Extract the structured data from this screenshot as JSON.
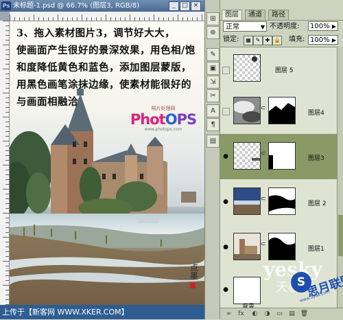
{
  "document": {
    "title": "未标题-1.psd @ 66.7% (图层3, RGB/8)",
    "instruction_lines": [
      "3、拖入素材图片3，调节好大大，",
      "使画面产生很好的景深效果，用色相/饱",
      "和度降低黄色和蓝色，添加图层蒙版，",
      "用黑色画笔涂抹边缘，使素材能很好的",
      "与画面相融洽"
    ],
    "logo_small": "照片处理网",
    "logo_big": "PhotoPS",
    "logo_url": "www.photops.com",
    "signature": "点墨",
    "footer": "上传于【新客网 WWW.XKER.COM】"
  },
  "tools": [
    "⊞",
    "⊕",
    "✎",
    "▣",
    "⇲",
    "✂",
    "A",
    "¶",
    "▤"
  ],
  "layers_panel": {
    "tabs": [
      "图层",
      "通道",
      "路径"
    ],
    "active_tab": 0,
    "blend_mode": "正常",
    "opacity_label": "不透明度:",
    "opacity_value": "100%",
    "lock_label": "锁定:",
    "fill_label": "填充:",
    "fill_value": "100%",
    "layers": [
      {
        "name": "图层 5",
        "visible": false,
        "mask": false,
        "selected": false
      },
      {
        "name": "图层4",
        "visible": false,
        "mask": true,
        "selected": false
      },
      {
        "name": "图层3",
        "visible": true,
        "mask": true,
        "selected": true
      },
      {
        "name": "图层 2",
        "visible": true,
        "mask": true,
        "selected": false
      },
      {
        "name": "图层1",
        "visible": true,
        "mask": true,
        "selected": false
      },
      {
        "name": "背景",
        "visible": true,
        "mask": false,
        "selected": false
      }
    ],
    "bottom_icons": [
      "∞",
      "fx",
      "◐",
      "◑",
      "▭",
      "▤",
      "🗑"
    ]
  },
  "watermark": {
    "text": "yesky",
    "sub": "天极网",
    "circle": "S",
    "cn": "思月联盟",
    "url": "www.5yue.com"
  },
  "colors": {
    "titlebar": "#4a6b92",
    "selected_layer": "#8a9a67",
    "panel_bg": "#cdd3be",
    "footer_bg": "#2f5d92"
  }
}
